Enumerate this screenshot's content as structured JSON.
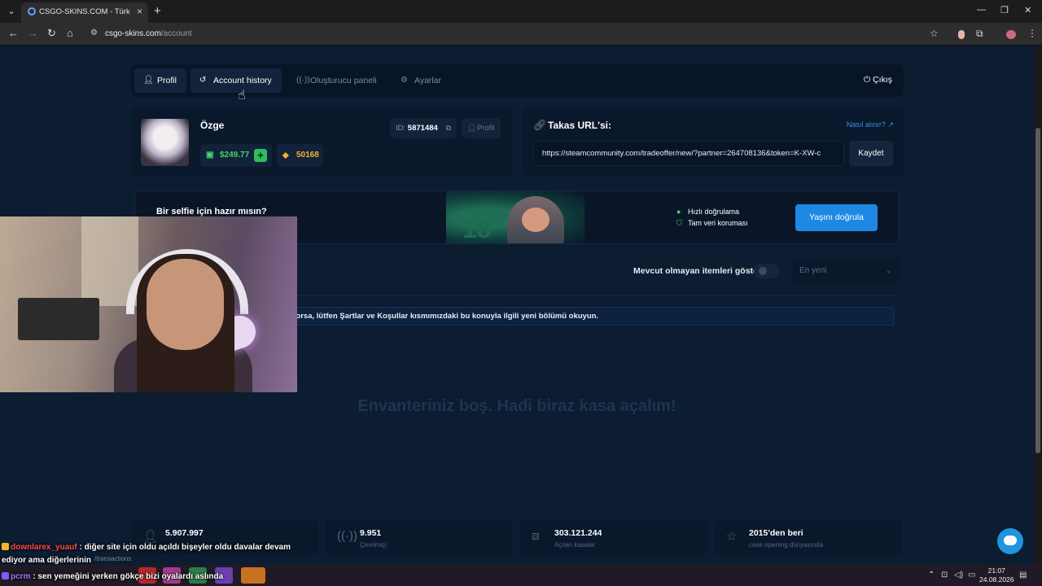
{
  "browser": {
    "tab_title": "CSGO-SKINS.COM - Türkiye'nin",
    "url_host": "csgo-skins.com",
    "url_path": "/account"
  },
  "nav": {
    "tabs": [
      {
        "label": "Profil",
        "icon": "user-icon"
      },
      {
        "label": "Account history",
        "icon": "history-icon"
      },
      {
        "label": "Oluşturucu paneli",
        "icon": "broadcast-icon"
      },
      {
        "label": "Ayarlar",
        "icon": "gear-icon"
      }
    ],
    "logout_label": "Çıkış"
  },
  "profile": {
    "username": "Özge",
    "balance": "$249.77",
    "coins": "50168",
    "id_label": "ID:",
    "id_value": "5871484",
    "profile_button": "Profil"
  },
  "trade_url": {
    "title": "Takas URL'si:",
    "help_link": "Nasıl alınır?",
    "value": "https://steamcommunity.com/tradeoffer/new/?partner=264708136&token=K-XW-c",
    "save_label": "Kaydet"
  },
  "selfie": {
    "title": "Bir selfie için hazır mısın?",
    "feature_1": "Hızlı doğrulama",
    "feature_2": "Tam veri koruması",
    "button": "Yaşını doğrula",
    "art_number": "18"
  },
  "inventory": {
    "toggle_label": "Mevcut olmayan itemleri göster",
    "sort_value": "En yeni",
    "notice": "eri almamalısınız. Bunu yapmanız gerekiyorsa, lütfen Şartlar ve Koşullar kısmımızdaki bu konuyla ilgili yeni bölümü okuyun.",
    "empty_text": "Envanteriniz boş. Hadi biraz kasa açalım!"
  },
  "stats": [
    {
      "value": "5.907.997",
      "label": "",
      "icon": "user-icon"
    },
    {
      "value": "9.951",
      "label": "Çevrimiçi",
      "icon": "broadcast-icon"
    },
    {
      "value": "303.121.244",
      "label": "Açılan kasalar",
      "icon": "box-icon"
    },
    {
      "value": "2015'den beri",
      "label": "case opening dünyasında",
      "icon": "star-icon"
    }
  ],
  "chat": {
    "msg1_user": "downlarex_yuauf",
    "msg1_text": ": diğer site için oldu açıldı bişeyler oldu davalar devam",
    "msg1_cont": "ediyor ama diğerlerinin",
    "msg2_user": "pcrm",
    "msg2_text": ": sen yemeğini yerken gökçe bizi oyalardı aslında",
    "ghost_text": "/transactions"
  },
  "taskbar": {
    "time": "21:07",
    "date": "24.08.2026"
  }
}
